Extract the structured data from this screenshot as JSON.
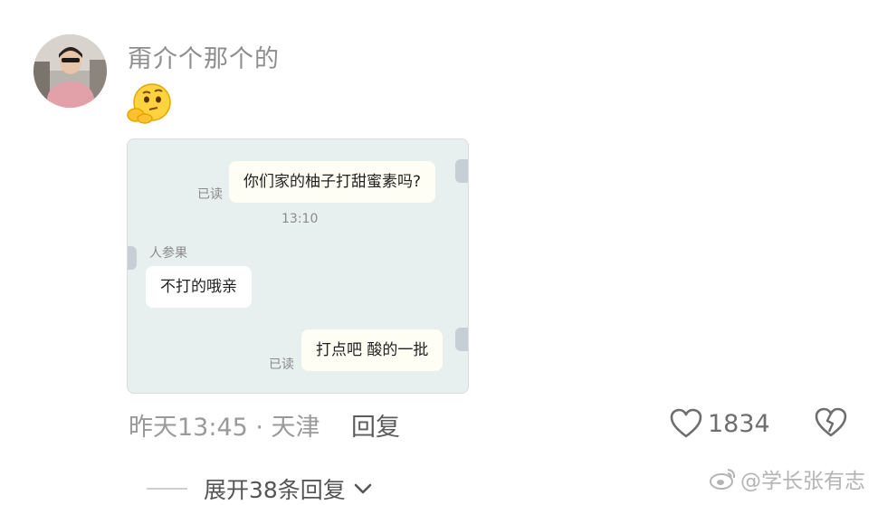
{
  "comment": {
    "username": "甭介个那个的",
    "emoji_icon": "thinking-face-emoji",
    "time_location": "昨天13:45 · 天津",
    "reply_label": "回复",
    "like_count": "1834",
    "expand_label": "展开38条回复"
  },
  "chat_screenshot": {
    "msg1": "你们家的柚子打甜蜜素吗?",
    "msg1_status": "已读",
    "timestamp": "13:10",
    "sender_name": "人参果",
    "msg2": "不打的哦亲",
    "msg3": "打点吧 酸的一批",
    "msg3_status": "已读"
  },
  "watermark": "@学长张有志",
  "colors": {
    "chat_bg": "#e7efef",
    "bubble_self": "#fffef5",
    "bubble_other": "#ffffff",
    "meta_text": "#9a9a9a"
  }
}
